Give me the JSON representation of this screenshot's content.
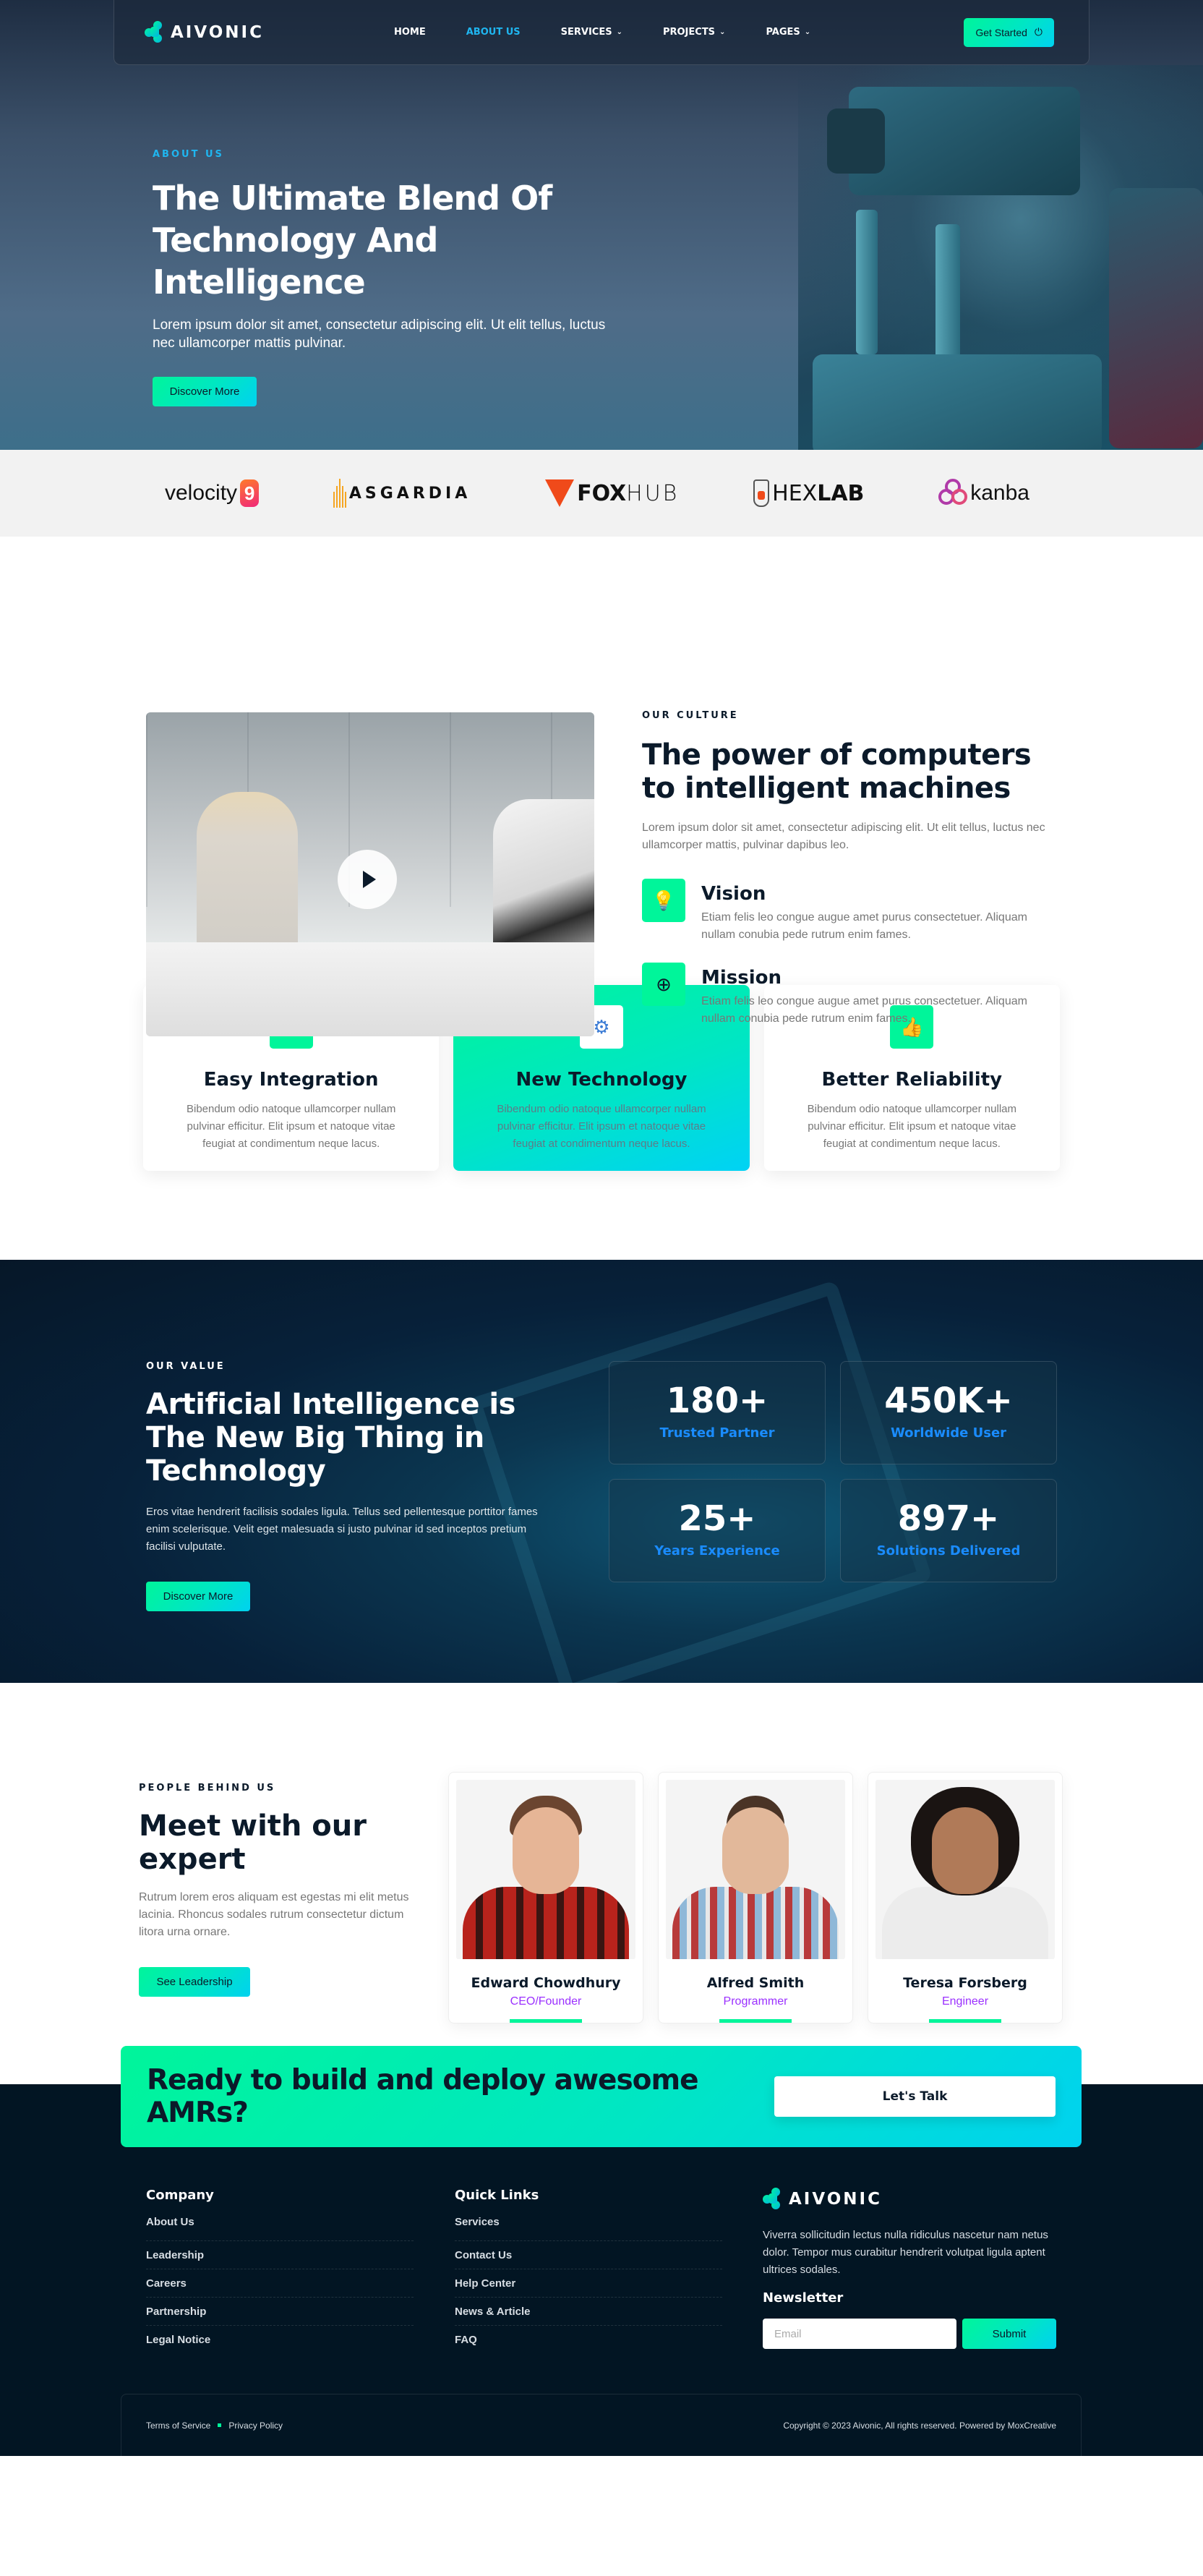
{
  "brand": {
    "name": "AIVONIC"
  },
  "nav": {
    "items": [
      {
        "label": "HOME",
        "active": false,
        "dropdown": false
      },
      {
        "label": "ABOUT US",
        "active": true,
        "dropdown": false
      },
      {
        "label": "SERVICES",
        "active": false,
        "dropdown": true
      },
      {
        "label": "PROJECTS",
        "active": false,
        "dropdown": true
      },
      {
        "label": "PAGES",
        "active": false,
        "dropdown": true
      }
    ],
    "cta_label": "Get Started"
  },
  "hero": {
    "eyebrow": "ABOUT US",
    "title": "The Ultimate Blend Of Technology And Intelligence",
    "text": "Lorem ipsum dolor sit amet, consectetur adipiscing elit. Ut elit tellus, luctus nec ullamcorper mattis pulvinar.",
    "button": "Discover More"
  },
  "partners": [
    {
      "name": "velocity",
      "suffix": "9"
    },
    {
      "name": "ASGARDIA"
    },
    {
      "name_bold": "FOX",
      "name_light": "HUB"
    },
    {
      "name_light": "HEX",
      "name_bold": "LAB"
    },
    {
      "name": "kanba"
    }
  ],
  "culture": {
    "eyebrow": "OUR CULTURE",
    "title": "The power of computers to intelligent machines",
    "text": "Lorem ipsum dolor sit amet, consectetur adipiscing elit. Ut elit tellus, luctus nec ullamcorper mattis, pulvinar dapibus leo.",
    "features": [
      {
        "icon": "lightbulb",
        "title": "Vision",
        "text": "Etiam felis leo congue augue amet purus consectetuer. Aliquam nullam conubia pede rutrum enim fames."
      },
      {
        "icon": "target",
        "title": "Mission",
        "text": "Etiam felis leo congue augue amet purus consectetuer. Aliquam nullam conubia pede rutrum enim fames."
      }
    ]
  },
  "services": [
    {
      "icon": "cloud-server",
      "title": "Easy Integration",
      "text": "Bibendum odio natoque ullamcorper nullam pulvinar efficitur. Elit ipsum et natoque vitae feugiat at condimentum neque lacus.",
      "highlighted": false
    },
    {
      "icon": "gear-brain",
      "title": "New Technology",
      "text": "Bibendum odio natoque ullamcorper nullam pulvinar efficitur. Elit ipsum et natoque vitae feugiat at condimentum neque lacus.",
      "highlighted": true
    },
    {
      "icon": "badge-thumbs-up",
      "title": "Better Reliability",
      "text": "Bibendum odio natoque ullamcorper nullam pulvinar efficitur. Elit ipsum et natoque vitae feugiat at condimentum neque lacus.",
      "highlighted": false
    }
  ],
  "value": {
    "eyebrow": "OUR VALUE",
    "title": "Artificial Intelligence is The New Big Thing in Technology",
    "text": "Eros vitae hendrerit facilisis sodales ligula. Tellus sed pellentesque porttitor fames enim scelerisque. Velit eget malesuada si justo pulvinar id sed inceptos pretium facilisi vulputate.",
    "button": "Discover More",
    "stats": [
      {
        "value": "180+",
        "label": "Trusted Partner"
      },
      {
        "value": "450K+",
        "label": "Worldwide User"
      },
      {
        "value": "25+",
        "label": "Years Experience"
      },
      {
        "value": "897+",
        "label": "Solutions Delivered"
      }
    ]
  },
  "team": {
    "eyebrow": "PEOPLE BEHIND US",
    "title": "Meet with our expert",
    "text": "Rutrum lorem eros aliquam est egestas mi elit metus lacinia. Rhoncus sodales rutrum consectetur dictum litora urna ornare.",
    "button": "See Leadership",
    "members": [
      {
        "name": "Edward Chowdhury",
        "role": "CEO/Founder"
      },
      {
        "name": "Alfred Smith",
        "role": "Programmer"
      },
      {
        "name": "Teresa Forsberg",
        "role": "Engineer"
      }
    ]
  },
  "cta": {
    "title": "Ready to build and deploy awesome AMRs?",
    "button": "Let's Talk"
  },
  "footer": {
    "company": {
      "title": "Company",
      "links": [
        "About Us",
        "Leadership",
        "Careers",
        "Partnership",
        "Legal Notice"
      ]
    },
    "quick": {
      "title": "Quick Links",
      "links": [
        "Services",
        "Contact Us",
        "Help Center",
        "News & Article",
        "FAQ"
      ]
    },
    "about": "Viverra sollicitudin lectus nulla ridiculus nascetur nam netus dolor. Tempor mus curabitur hendrerit volutpat ligula aptent ultrices sodales.",
    "newsletter": {
      "title": "Newsletter",
      "placeholder": "Email",
      "value": "",
      "button": "Submit"
    },
    "legal": [
      "Terms of Service",
      "Privacy Policy"
    ],
    "copyright": "Copyright © 2023 Aivonic, All rights reserved. Powered by MoxCreative"
  },
  "colors": {
    "accent_green": "#00f59a",
    "accent_cyan": "#00d2f0",
    "link_blue": "#1fb6f0",
    "stat_blue": "#1a8cff",
    "role_purple": "#9b30ff",
    "dark_bg": "#021523"
  }
}
